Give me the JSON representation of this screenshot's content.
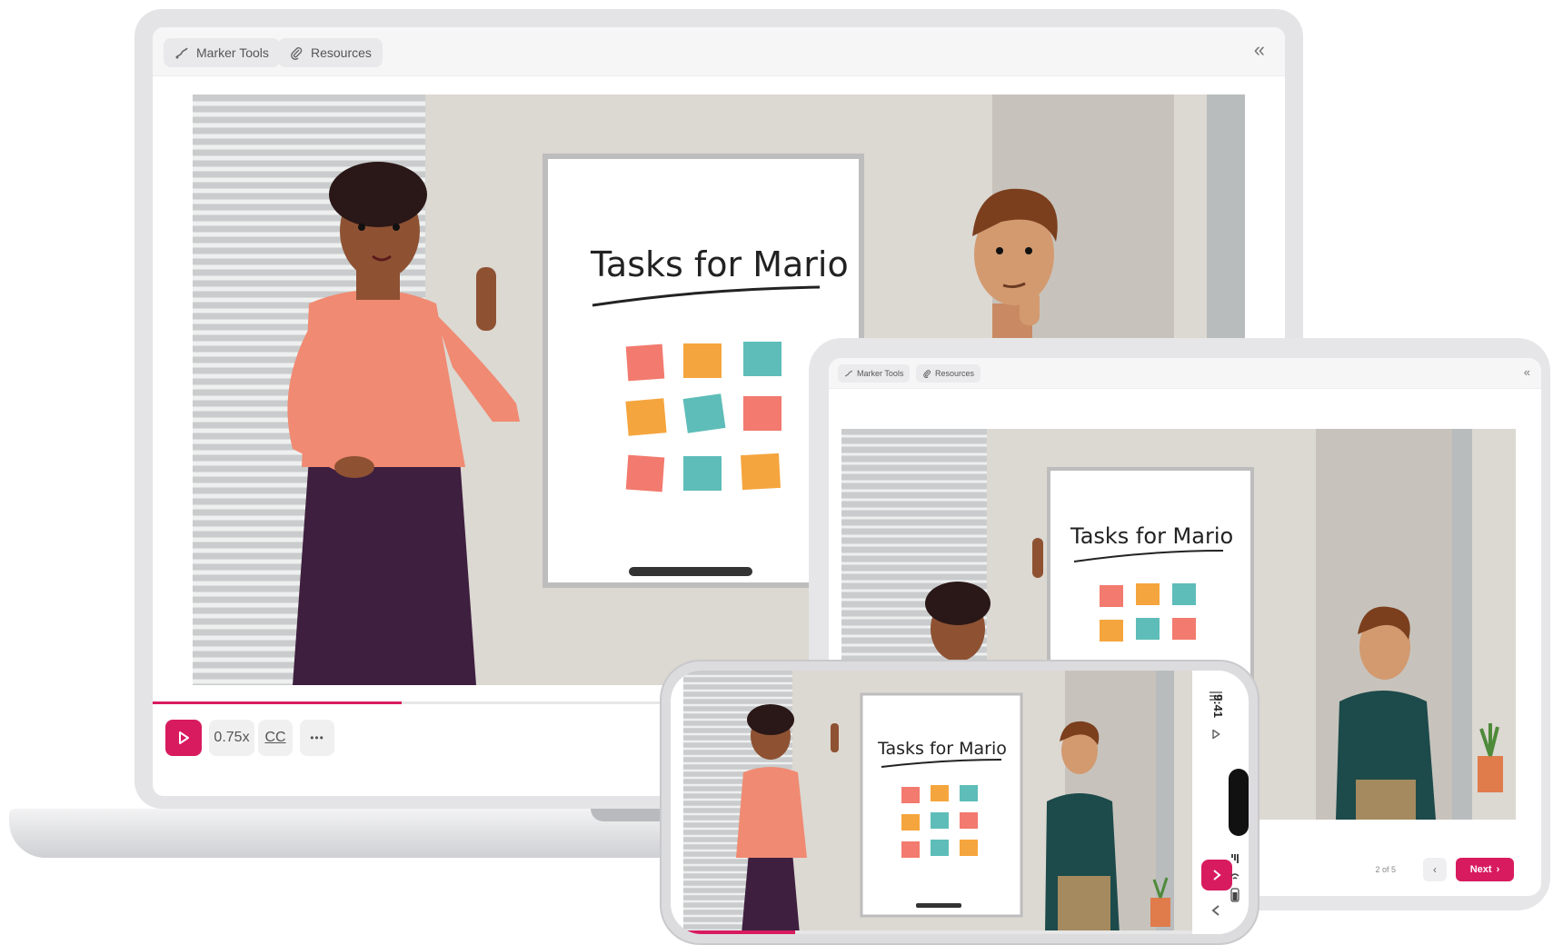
{
  "laptop": {
    "toolbar": {
      "marker_tools": "Marker Tools",
      "resources": "Resources",
      "collapse_icon": "double-chevron-left-icon"
    },
    "scene": {
      "whiteboard_title": "Tasks for Mario"
    },
    "controls": {
      "speed": "0.75x",
      "captions": "CC",
      "more": "•••"
    },
    "progress": 0.22
  },
  "tablet": {
    "toolbar": {
      "marker_tools": "Marker Tools",
      "resources": "Resources"
    },
    "scene": {
      "whiteboard_title": "Tasks for Mario"
    },
    "footer": {
      "page_indicator": "2 of 5",
      "prev": "‹",
      "next_label": "Next",
      "next_arrow": "›"
    }
  },
  "phone": {
    "time": "9:41",
    "scene": {
      "whiteboard_title": "Tasks for Mario"
    },
    "progress": 0.22
  },
  "colors": {
    "accent": "#d81b5f",
    "shirt": "#f08a72",
    "cardigan": "#1d4a4a",
    "sticky_pink": "#f27a6e",
    "sticky_orange": "#f5a53d",
    "sticky_teal": "#5ebdb8"
  }
}
